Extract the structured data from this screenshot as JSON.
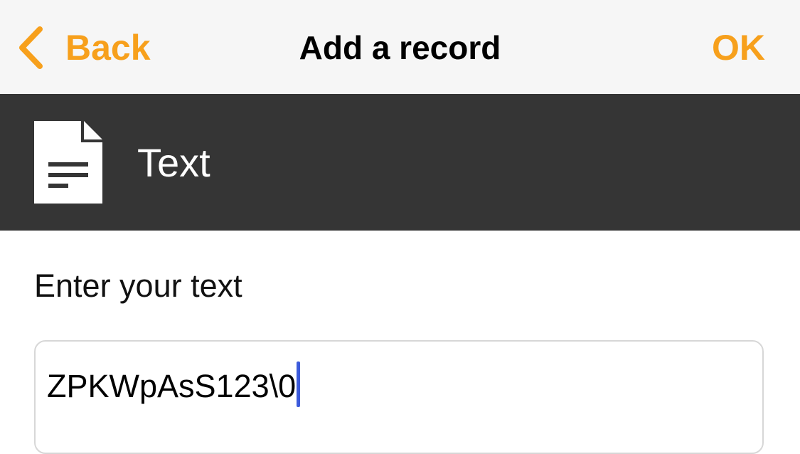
{
  "nav": {
    "back_label": "Back",
    "title": "Add a record",
    "ok_label": "OK"
  },
  "record_header": {
    "icon": "document-icon",
    "type_label": "Text"
  },
  "form": {
    "prompt": "Enter your text",
    "text_value": "ZPKWpAsS123\\0"
  },
  "colors": {
    "accent": "#f7a01c",
    "header_bg": "#353535",
    "nav_bg": "#f6f6f6",
    "caret": "#3d5bdb"
  }
}
